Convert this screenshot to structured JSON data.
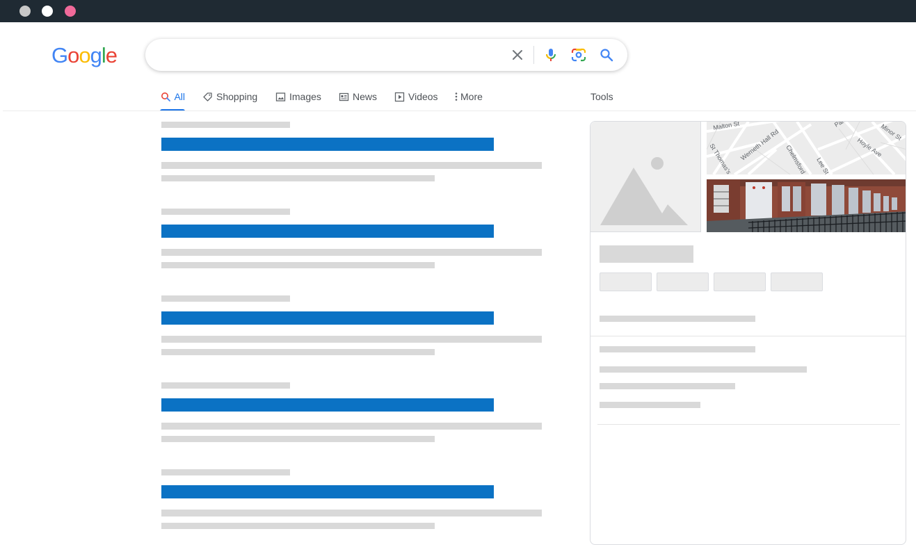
{
  "window": {
    "traffic_lights": [
      "#c8c8c8",
      "#ffffff",
      "#f06a9a"
    ]
  },
  "header": {
    "logo_letters": [
      {
        "char": "G",
        "color": "#4285F4"
      },
      {
        "char": "o",
        "color": "#EA4335"
      },
      {
        "char": "o",
        "color": "#FBBC05"
      },
      {
        "char": "g",
        "color": "#4285F4"
      },
      {
        "char": "l",
        "color": "#34A853"
      },
      {
        "char": "e",
        "color": "#EA4335"
      }
    ]
  },
  "search": {
    "value": "",
    "icons": [
      "close-icon",
      "microphone-icon",
      "google-lens-icon",
      "search-icon"
    ]
  },
  "tabs": [
    {
      "label": "All",
      "icon": "search-icon",
      "active": true
    },
    {
      "label": "Shopping",
      "icon": "tag-icon",
      "active": false
    },
    {
      "label": "Images",
      "icon": "image-icon",
      "active": false
    },
    {
      "label": "News",
      "icon": "newspaper-icon",
      "active": false
    },
    {
      "label": "Videos",
      "icon": "play-icon",
      "active": false
    },
    {
      "label": "More",
      "icon": "more-vertical-icon",
      "active": false
    }
  ],
  "tools_label": "Tools",
  "results": {
    "count": 5,
    "colors": {
      "placeholder": "#d9d9d9",
      "title": "#0b72c4"
    }
  },
  "knowledge_panel": {
    "map_labels": [
      "Malton St",
      "Werneth Hall Rd",
      "Chelmsford",
      "Lee St",
      "Hoyle Ave",
      "Minor St",
      "St Thomas's",
      "Par"
    ],
    "chips": 4
  }
}
